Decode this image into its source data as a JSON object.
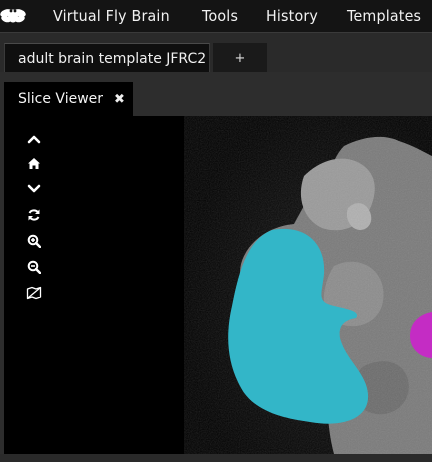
{
  "menubar": {
    "logo_icon": "fly-icon",
    "items": [
      "Virtual Fly Brain",
      "Tools",
      "History",
      "Templates"
    ]
  },
  "tabs": {
    "main_label": "adult brain template JFRC2",
    "add_label": "+"
  },
  "panel": {
    "title": "Slice Viewer",
    "close_label": "✖"
  },
  "controls": [
    "chevron-up-icon",
    "home-icon",
    "chevron-down-icon",
    "refresh-icon",
    "zoom-in-icon",
    "zoom-out-icon",
    "toggle-view-icon"
  ],
  "colors": {
    "menubar_bg": "#141414",
    "tabbar_bg": "#2a2a2a",
    "highlight_cyan": "#33b6c8",
    "highlight_magenta": "#c42cc4",
    "brain_gray": "#8a8a8a"
  }
}
